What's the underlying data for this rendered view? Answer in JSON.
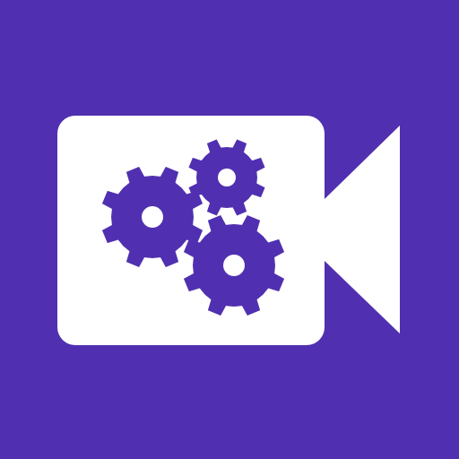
{
  "icon": {
    "name": "video-camera-settings-icon",
    "background_color": "#5030B0",
    "foreground_color": "#FFFFFF",
    "gear_color": "#5030B0"
  }
}
